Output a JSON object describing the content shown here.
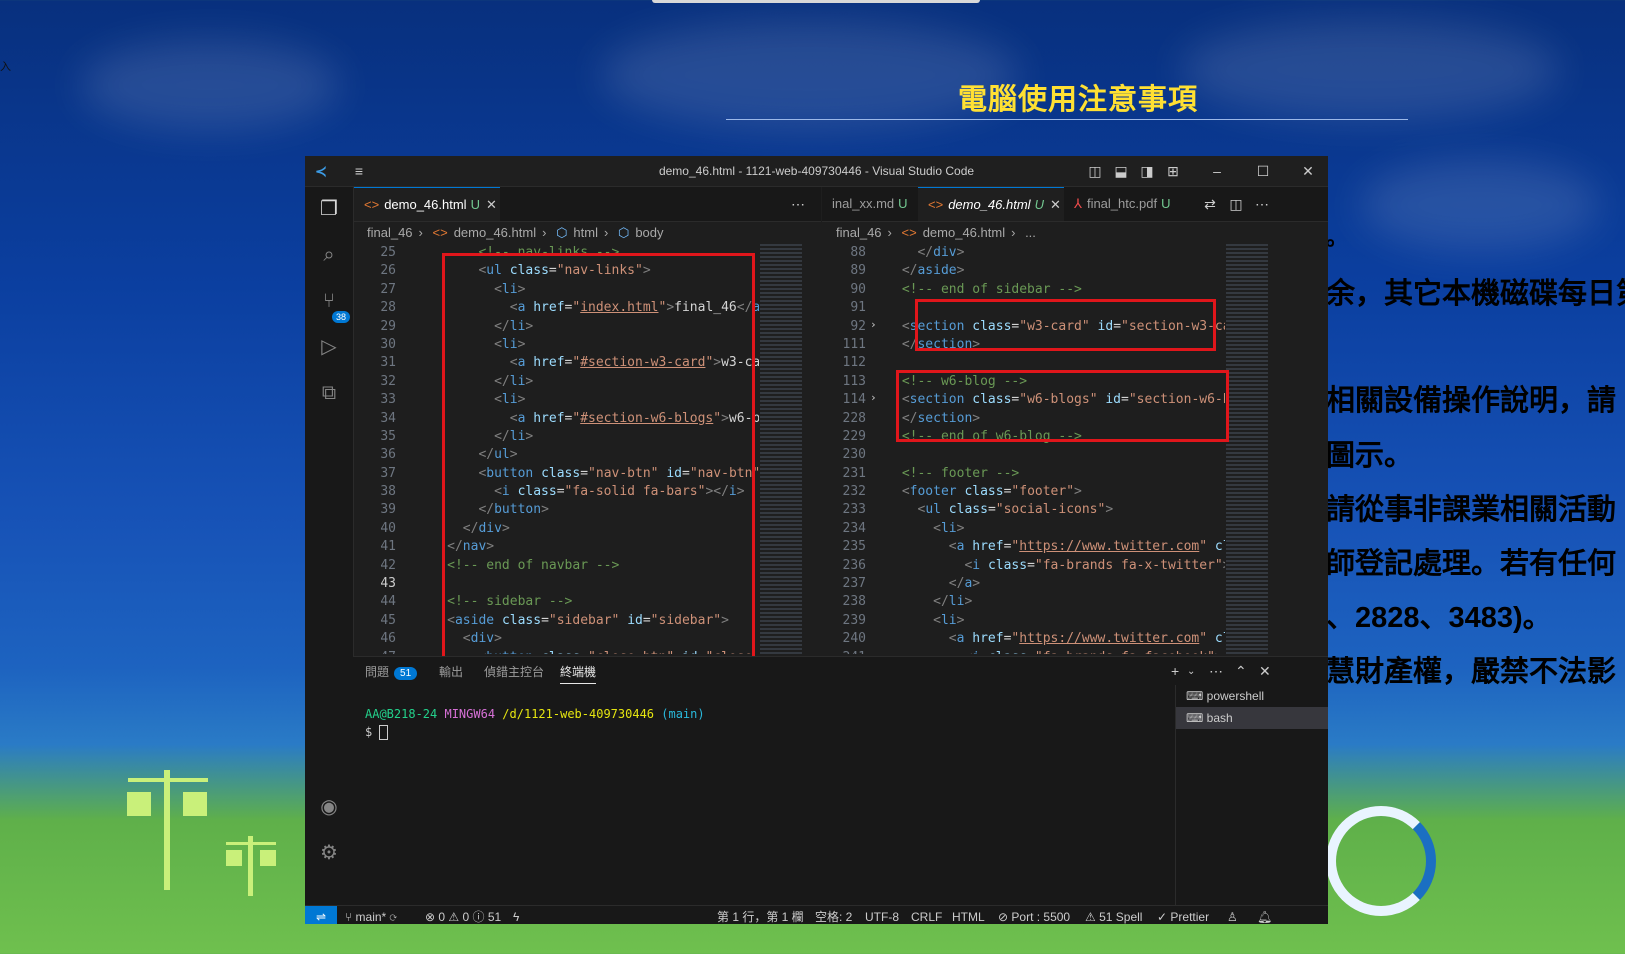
{
  "wallpaper": {
    "title": "電腦使用注意事項",
    "lines": [
      {
        "text": "。",
        "color": "#ffffff"
      },
      {
        "text": "余，其它本機磁碟每日第",
        "color": "#ffffff"
      },
      {
        "text": "相關設備操作說明，請",
        "color": "#ffe033"
      },
      {
        "text": "圖示。",
        "color": "#ffe033"
      },
      {
        "text": "請從事非課業相關活動",
        "color": "#c08cf0"
      },
      {
        "text": "師登記處理。若有任何",
        "color": "#ffe033"
      },
      {
        "text": "、2828、3483)。",
        "color": "#ffe033"
      },
      {
        "text": "慧財產權，嚴禁不法影",
        "color": "#ffffff"
      }
    ],
    "corner_mark": "入"
  },
  "window": {
    "title": "demo_46.html - 1121-web-409730446 - Visual Studio Code"
  },
  "activity": {
    "scm_badge": "38"
  },
  "left_group": {
    "tab": {
      "label": "demo_46.html",
      "status": "U"
    },
    "breadcrumb": [
      "final_46",
      "demo_46.html",
      "html",
      "body"
    ],
    "line_numbers": [
      "25",
      "26",
      "27",
      "28",
      "29",
      "30",
      "31",
      "32",
      "33",
      "34",
      "35",
      "36",
      "37",
      "38",
      "39",
      "40",
      "41",
      "42",
      "43",
      "44",
      "45",
      "46",
      "47"
    ],
    "current_line": "43"
  },
  "right_group": {
    "tabs": [
      {
        "label": "inal_xx.md",
        "status": "U"
      },
      {
        "label": "demo_46.html",
        "status": "U"
      },
      {
        "label": "final_htc.pdf",
        "status": "U"
      }
    ],
    "breadcrumb": [
      "final_46",
      "demo_46.html",
      "..."
    ],
    "line_numbers": [
      "88",
      "89",
      "90",
      "91",
      "92",
      "111",
      "112",
      "113",
      "114",
      "228",
      "229",
      "230",
      "231",
      "232",
      "233",
      "234",
      "235",
      "236",
      "237",
      "238",
      "239",
      "240",
      "241"
    ]
  },
  "panel": {
    "tabs": [
      "問題",
      "輸出",
      "偵錯主控台",
      "終端機"
    ],
    "problems_count": "51",
    "terminal": {
      "user": "AA@B218-24",
      "env": "MINGW64",
      "path": "/d/1121-web-409730446",
      "branch": "(main)",
      "prompt": "$"
    },
    "terminals": [
      "powershell",
      "bash"
    ]
  },
  "status": {
    "branch": "main*",
    "errors": "0",
    "warnings": "0",
    "infos": "51",
    "position": "第 1 行，第 1 欄",
    "spaces": "空格: 2",
    "encoding": "UTF-8",
    "eol": "CRLF",
    "language": "HTML",
    "port": "Port : 5500",
    "spell": "51 Spell",
    "prettier": "Prettier"
  }
}
